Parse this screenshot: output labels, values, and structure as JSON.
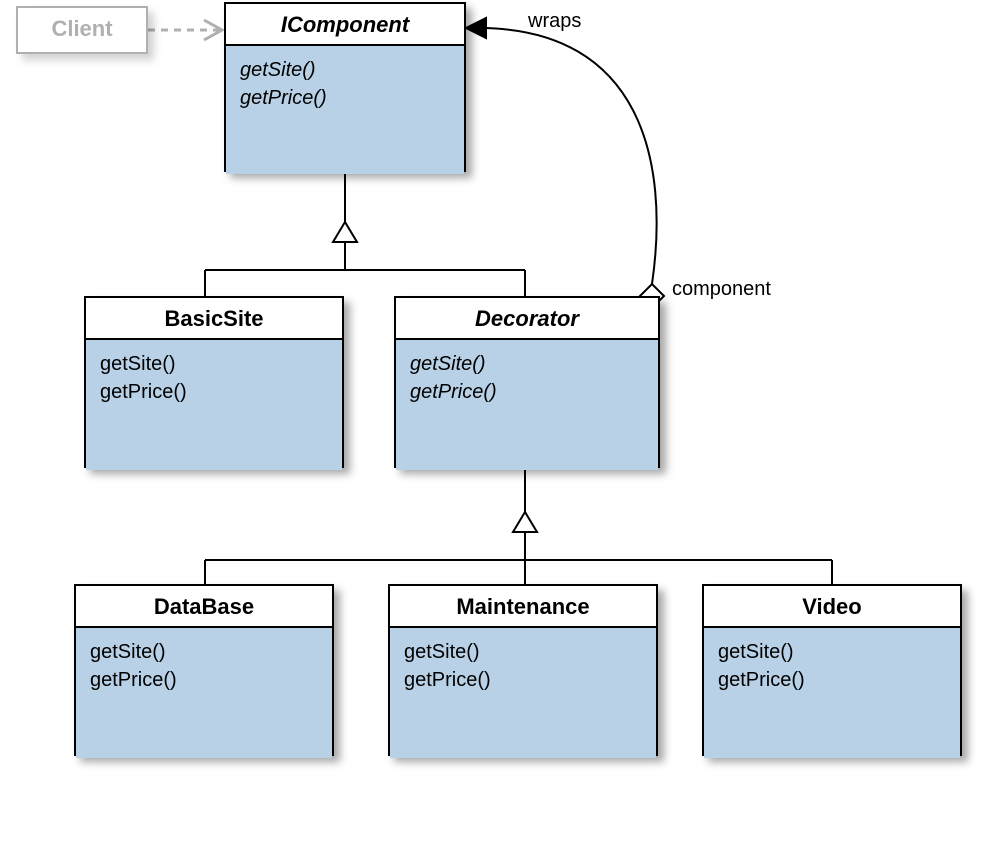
{
  "client": {
    "title": "Client"
  },
  "icomponent": {
    "title": "IComponent",
    "methods": [
      "getSite()",
      "getPrice()"
    ]
  },
  "basicsite": {
    "title": "BasicSite",
    "methods": [
      "getSite()",
      "getPrice()"
    ]
  },
  "decorator": {
    "title": "Decorator",
    "methods": [
      "getSite()",
      "getPrice()"
    ]
  },
  "database": {
    "title": "DataBase",
    "methods": [
      "getSite()",
      "getPrice()"
    ]
  },
  "maintenance": {
    "title": "Maintenance",
    "methods": [
      "getSite()",
      "getPrice()"
    ]
  },
  "video": {
    "title": "Video",
    "methods": [
      "getSite()",
      "getPrice()"
    ]
  },
  "labels": {
    "wraps": "wraps",
    "component": "component"
  }
}
